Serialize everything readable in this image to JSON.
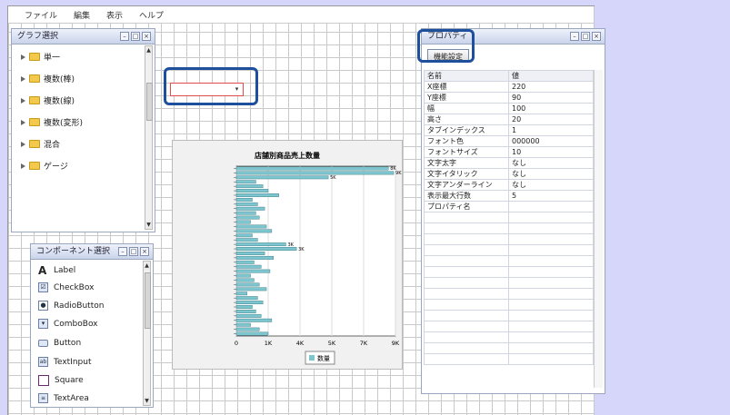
{
  "menu": [
    "ファイル",
    "編集",
    "表示",
    "ヘルプ"
  ],
  "graph_panel": {
    "title": "グラフ選択",
    "items": [
      "単一",
      "複数(棒)",
      "複数(線)",
      "複数(変形)",
      "混合",
      "ゲージ"
    ]
  },
  "component_panel": {
    "title": "コンポーネント選択",
    "items": [
      {
        "label": "Label",
        "icon": "letter-a-icon"
      },
      {
        "label": "CheckBox",
        "icon": "checkbox-icon"
      },
      {
        "label": "RadioButton",
        "icon": "radio-icon"
      },
      {
        "label": "ComboBox",
        "icon": "combobox-icon"
      },
      {
        "label": "Button",
        "icon": "button-icon"
      },
      {
        "label": "TextInput",
        "icon": "textinput-icon"
      },
      {
        "label": "Square",
        "icon": "square-icon"
      },
      {
        "label": "TextArea",
        "icon": "textarea-icon"
      }
    ]
  },
  "property_panel": {
    "title": "プロパティ",
    "func_button": "機能設定",
    "headers": [
      "名前",
      "値"
    ],
    "rows": [
      [
        "X座標",
        "220"
      ],
      [
        "Y座標",
        "90"
      ],
      [
        "幅",
        "100"
      ],
      [
        "高さ",
        "20"
      ],
      [
        "タブインデックス",
        "1"
      ],
      [
        "フォント色",
        "000000"
      ],
      [
        "フォントサイズ",
        "10"
      ],
      [
        "文字太字",
        "なし"
      ],
      [
        "文字イタリック",
        "なし"
      ],
      [
        "文字アンダーライン",
        "なし"
      ],
      [
        "表示最大行数",
        "5"
      ],
      [
        "プロパティ名",
        ""
      ]
    ]
  },
  "chart_data": {
    "type": "bar",
    "orientation": "horizontal",
    "title": "店舗別商品売上数量",
    "legend": "数量",
    "xticks": [
      "0",
      "1K",
      "4K",
      "5K",
      "7K",
      "9K"
    ],
    "xlim": [
      0,
      9000
    ],
    "values": [
      8600,
      8900,
      5200,
      1100,
      1500,
      1800,
      2400,
      900,
      1200,
      1600,
      1100,
      1300,
      800,
      1700,
      2000,
      900,
      1200,
      2800,
      3400,
      1600,
      2100,
      1000,
      1400,
      1900,
      800,
      1000,
      1300,
      1700,
      600,
      1200,
      1500,
      900,
      1100,
      1400,
      2000,
      800,
      1300,
      1800
    ],
    "data_labels": [
      "8K",
      "9K",
      "5K",
      "",
      "",
      "",
      "",
      "",
      "",
      "",
      "",
      "",
      "",
      "",
      "",
      "",
      "",
      "3K",
      "3K"
    ],
    "bar_color": "#7ec6cf",
    "grid": true
  }
}
